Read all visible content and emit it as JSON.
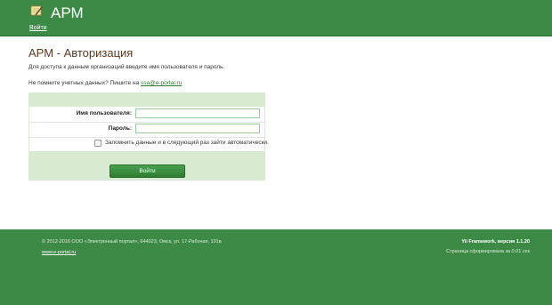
{
  "header": {
    "app_title": "АРМ",
    "nav_login": "Войти",
    "logo_icon": "notepad-pencil-icon"
  },
  "main": {
    "title": "АРМ - Авторизация",
    "intro": "Для доступа к данным организаций введите имя пользователя и пароль.",
    "forgot_text": "Не помните учетных данных? Пишите на ",
    "forgot_email": "ssa@e-portal.ru"
  },
  "form": {
    "username_label": "Имя пользователя:",
    "username_value": "",
    "password_label": "Пароль:",
    "password_value": "",
    "remember_label": "Запомнить данные и в следующий раз зайти автоматически.",
    "remember_checked": false,
    "submit_label": "Войти"
  },
  "footer": {
    "copyright": "© 2012-2016 ООО «Электронный портал», 644023, Омск, ул. 17-Рабочая, 101в",
    "site_link": "www.e-portal.ru",
    "framework": "Yii Framework, версия 1.1.20",
    "gen_time": "Страница сформирована за 0.01 сек"
  },
  "colors": {
    "brand_green": "#3d8a47",
    "form_bg": "#d9ead3",
    "title_brown": "#5a3a22"
  }
}
